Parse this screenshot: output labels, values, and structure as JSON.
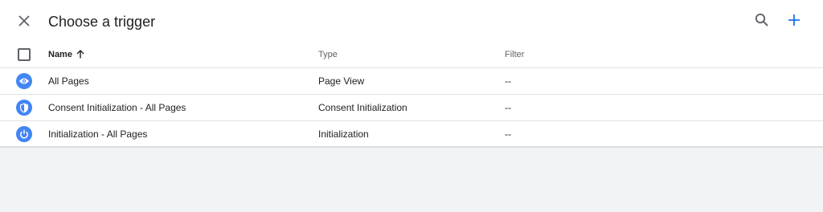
{
  "header": {
    "title": "Choose a trigger",
    "close_icon": "close-icon",
    "search_icon": "search-icon",
    "add_icon": "add-icon"
  },
  "table": {
    "columns": {
      "name": "Name",
      "type": "Type",
      "filter": "Filter"
    },
    "sort": "ascending",
    "rows": [
      {
        "icon": "eye-icon",
        "name": "All Pages",
        "type": "Page View",
        "filter": "--"
      },
      {
        "icon": "shield-icon",
        "name": "Consent Initialization - All Pages",
        "type": "Consent Initialization",
        "filter": "--"
      },
      {
        "icon": "power-icon",
        "name": "Initialization - All Pages",
        "type": "Initialization",
        "filter": "--"
      }
    ]
  },
  "colors": {
    "accent": "#1a73e8",
    "icon_badge": "#4285f4",
    "background": "#f1f3f4"
  }
}
